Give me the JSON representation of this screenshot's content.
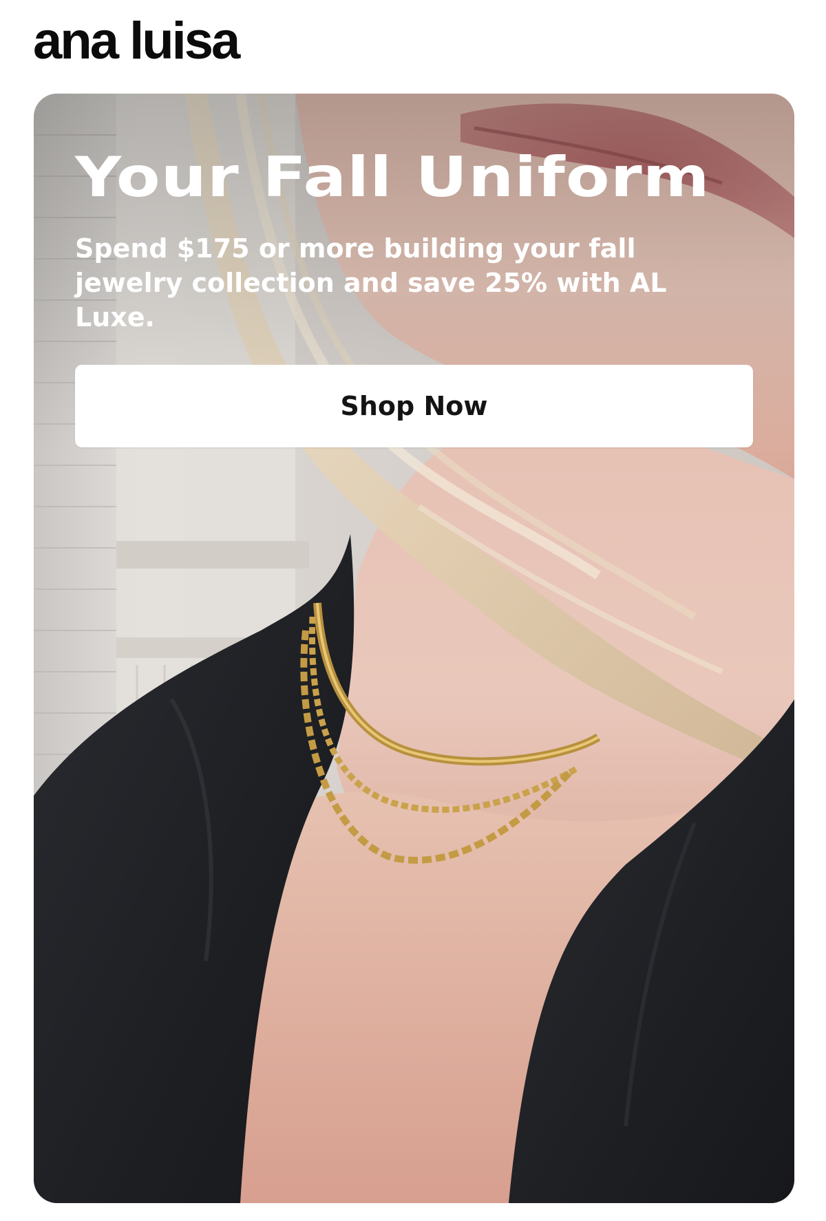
{
  "brand": {
    "logo_text": "ana luisa"
  },
  "hero": {
    "image_alt": "Model wearing layered gold chain necklaces and a black blazer",
    "headline": "Your Fall Uniform",
    "subtext": "Spend $175 or more building your fall jewelry collection and save 25% with AL Luxe.",
    "cta_label": "Shop Now"
  },
  "colors": {
    "page_background": "#ffffff",
    "logo": "#0b0b0b",
    "headline_text": "#ffffff",
    "button_background": "#ffffff",
    "button_text": "#141414",
    "blazer": "#1d1f23",
    "gold": "#c9a24c"
  }
}
